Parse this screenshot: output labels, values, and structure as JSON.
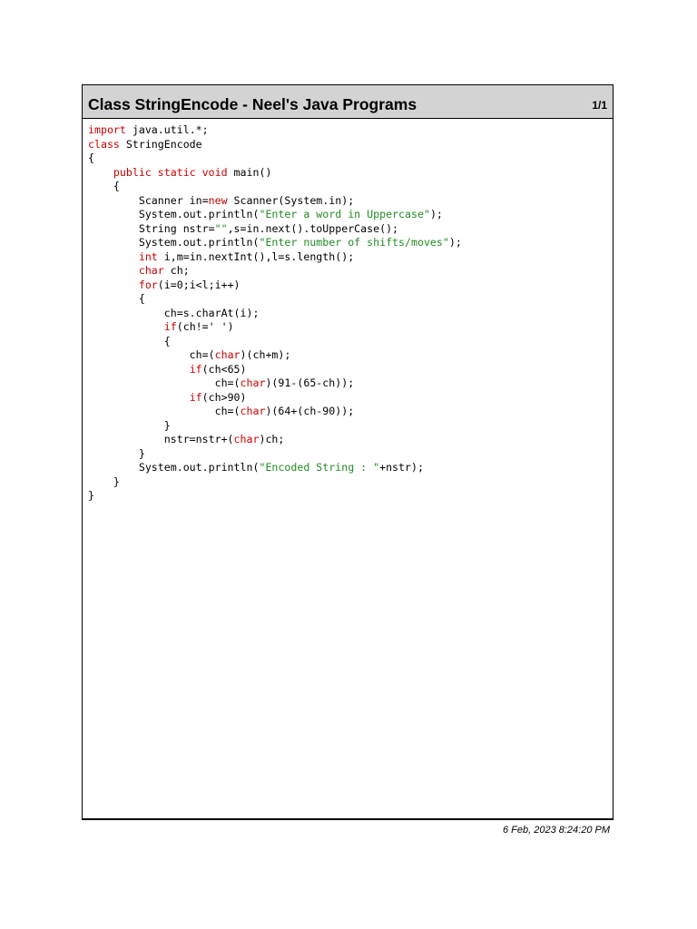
{
  "header": {
    "title": "Class StringEncode - Neel's Java Programs",
    "page": "1/1"
  },
  "colors": {
    "keyword": "#cc0000",
    "string": "#228b22",
    "text": "#000000",
    "header_bg": "#d3d3d3"
  },
  "code_lines": [
    [
      {
        "t": "import",
        "c": "kw"
      },
      {
        "t": " java.util.*;"
      }
    ],
    [
      {
        "t": "class",
        "c": "kw"
      },
      {
        "t": " StringEncode"
      }
    ],
    [
      {
        "t": "{"
      }
    ],
    [
      {
        "t": "    "
      },
      {
        "t": "public static void",
        "c": "kw"
      },
      {
        "t": " main()"
      }
    ],
    [
      {
        "t": "    {"
      }
    ],
    [
      {
        "t": "        Scanner in="
      },
      {
        "t": "new",
        "c": "kw"
      },
      {
        "t": " Scanner(System.in);"
      }
    ],
    [
      {
        "t": "        System.out.println("
      },
      {
        "t": "\"Enter a word in Uppercase\"",
        "c": "str"
      },
      {
        "t": ");"
      }
    ],
    [
      {
        "t": "        String nstr="
      },
      {
        "t": "\"\"",
        "c": "str"
      },
      {
        "t": ",s=in.next().toUpperCase();"
      }
    ],
    [
      {
        "t": "        System.out.println("
      },
      {
        "t": "\"Enter number of shifts/moves\"",
        "c": "str"
      },
      {
        "t": ");"
      }
    ],
    [
      {
        "t": "        "
      },
      {
        "t": "int",
        "c": "kw"
      },
      {
        "t": " i,m=in.nextInt(),l=s.length();"
      }
    ],
    [
      {
        "t": "        "
      },
      {
        "t": "char",
        "c": "kw"
      },
      {
        "t": " ch;"
      }
    ],
    [
      {
        "t": "        "
      },
      {
        "t": "for",
        "c": "kw"
      },
      {
        "t": "(i=0;i<l;i++)"
      }
    ],
    [
      {
        "t": "        {"
      }
    ],
    [
      {
        "t": "            ch=s.charAt(i);"
      }
    ],
    [
      {
        "t": "            "
      },
      {
        "t": "if",
        "c": "kw"
      },
      {
        "t": "(ch!=' ')"
      }
    ],
    [
      {
        "t": "            {"
      }
    ],
    [
      {
        "t": "                ch=("
      },
      {
        "t": "char",
        "c": "kw"
      },
      {
        "t": ")(ch+m);"
      }
    ],
    [
      {
        "t": "                "
      },
      {
        "t": "if",
        "c": "kw"
      },
      {
        "t": "(ch<65)"
      }
    ],
    [
      {
        "t": "                    ch=("
      },
      {
        "t": "char",
        "c": "kw"
      },
      {
        "t": ")(91-(65-ch));"
      }
    ],
    [
      {
        "t": "                "
      },
      {
        "t": "if",
        "c": "kw"
      },
      {
        "t": "(ch>90)"
      }
    ],
    [
      {
        "t": "                    ch=("
      },
      {
        "t": "char",
        "c": "kw"
      },
      {
        "t": ")(64+(ch-90));"
      }
    ],
    [
      {
        "t": "            }"
      }
    ],
    [
      {
        "t": "            nstr=nstr+("
      },
      {
        "t": "char",
        "c": "kw"
      },
      {
        "t": ")ch;"
      }
    ],
    [
      {
        "t": "        }"
      }
    ],
    [
      {
        "t": "        System.out.println("
      },
      {
        "t": "\"Encoded String : \"",
        "c": "str"
      },
      {
        "t": "+nstr);"
      }
    ],
    [
      {
        "t": "    }"
      }
    ],
    [
      {
        "t": "}"
      }
    ]
  ],
  "footer": {
    "date": "6 Feb, 2023 8:24:20 PM"
  }
}
